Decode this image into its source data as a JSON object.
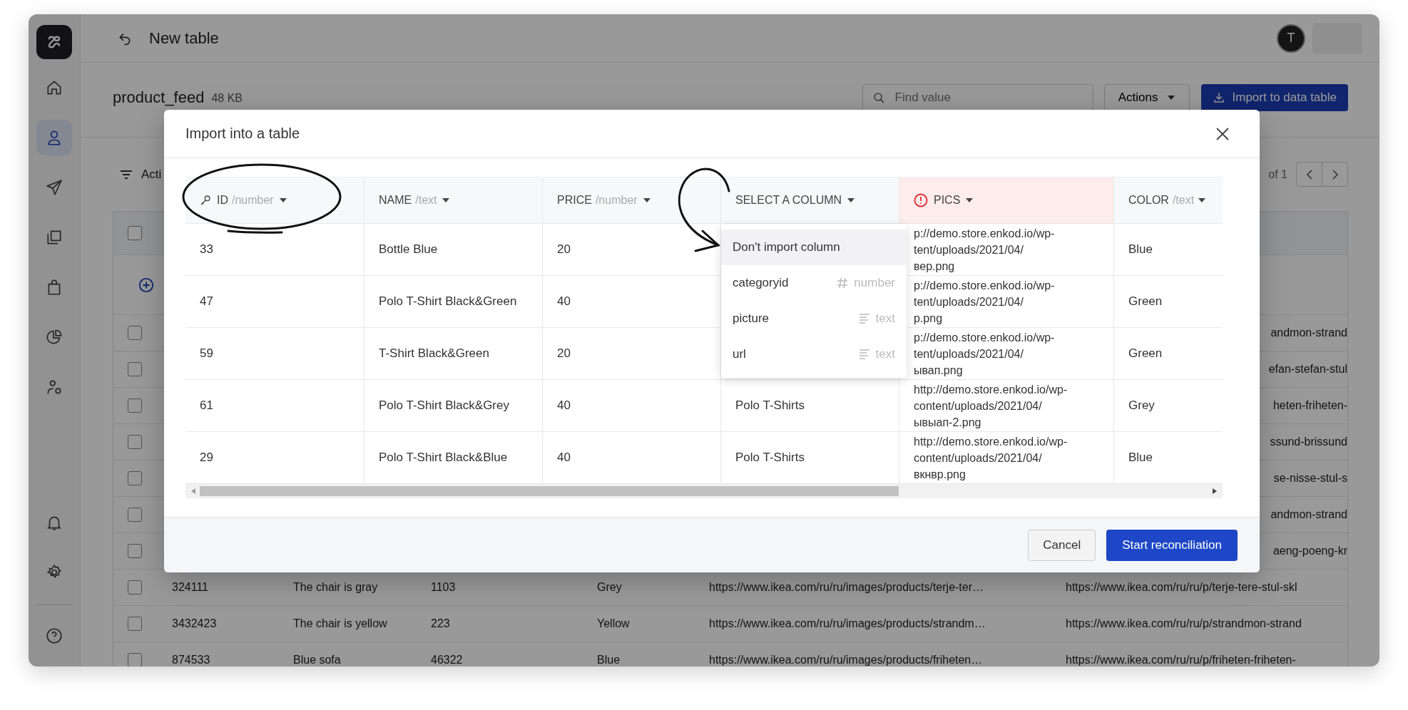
{
  "top_bar": {
    "title": "New table",
    "avatar": "T"
  },
  "sidebar": {
    "items": [
      {
        "selected": false
      },
      {
        "selected": true
      },
      {
        "selected": false
      },
      {
        "selected": false
      },
      {
        "selected": false
      },
      {
        "selected": false
      },
      {
        "selected": false
      }
    ]
  },
  "page": {
    "title": "product_feed",
    "size": "48 KB",
    "search": {
      "placeholder": "Find value"
    },
    "actions": "Actions",
    "import_button": "Import to data table",
    "toolbar_label": "Acti",
    "page_total": "of 1"
  },
  "data_table": {
    "all_checked": false,
    "rows": [
      {
        "kind": "partial",
        "checked": false,
        "fragment": "andmon-strand"
      },
      {
        "kind": "partial",
        "checked": false,
        "fragment": "efan-stefan-stul"
      },
      {
        "kind": "partial",
        "checked": false,
        "fragment": "heten-friheten-"
      },
      {
        "kind": "partial",
        "checked": false,
        "fragment": "ssund-brissund"
      },
      {
        "kind": "partial",
        "checked": false,
        "fragment": "se-nisse-stul-s"
      },
      {
        "kind": "partial",
        "checked": false,
        "fragment": "andmon-strand"
      },
      {
        "kind": "partial",
        "checked": false,
        "fragment": "aeng-poeng-kr"
      },
      {
        "kind": "full",
        "checked": false,
        "cells": [
          "324111",
          "The chair is gray",
          "1103",
          "Grey",
          "https://www.ikea.com/ru/ru/images/products/terje-ter…",
          "https://www.ikea.com/ru/ru/p/terje-tere-stul-skl"
        ]
      },
      {
        "kind": "full",
        "checked": false,
        "cells": [
          "3432423",
          "The chair is yellow",
          "223",
          "Yellow",
          "https://www.ikea.com/ru/ru/images/products/strandm…",
          "https://www.ikea.com/ru/ru/p/strandmon-strand"
        ]
      },
      {
        "kind": "full",
        "checked": false,
        "cells": [
          "874533",
          "Blue sofa",
          "46322",
          "Blue",
          "https://www.ikea.com/ru/ru/images/products/friheten…",
          "https://www.ikea.com/ru/ru/p/friheten-friheten-"
        ]
      }
    ]
  },
  "dialog": {
    "title": "Import into a table",
    "columns": [
      {
        "label": "ID",
        "type": "/number",
        "key": true,
        "error": false
      },
      {
        "label": "NAME",
        "type": "/text",
        "key": false,
        "error": false
      },
      {
        "label": "PRICE",
        "type": "/number",
        "key": false,
        "error": false
      },
      {
        "label": "SELECT A COLUMN",
        "key": false,
        "error": false
      },
      {
        "label": "PICS",
        "key": false,
        "error": true
      },
      {
        "label": "COLOR",
        "type": "/text",
        "key": false,
        "error": false
      }
    ],
    "rows": [
      {
        "id": "33",
        "name": "Bottle Blue",
        "price": "20",
        "pics": "p://demo.store.enkod.io/wp-\ntent/uploads/2021/04/\nвер.png",
        "color_text": "Blue"
      },
      {
        "id": "47",
        "name": "Polo T-Shirt Black&Green",
        "price": "40",
        "pics": "p://demo.store.enkod.io/wp-\ntent/uploads/2021/04/\np.png",
        "color_text": "Green"
      },
      {
        "id": "59",
        "name": "T-Shirt Black&Green",
        "price": "20",
        "pics": "p://demo.store.enkod.io/wp-\ntent/uploads/2021/04/\nывап.png",
        "color_text": "Green"
      },
      {
        "id": "61",
        "name": "Polo T-Shirt Black&Grey",
        "price": "40",
        "select_column": "Polo T-Shirts",
        "pics": "http://demo.store.enkod.io/wp-\ncontent/uploads/2021/04/\nывыап-2.png",
        "color_text": "Grey"
      },
      {
        "id": "29",
        "name": "Polo T-Shirt Black&Blue",
        "price": "40",
        "select_column": "Polo T-Shirts",
        "pics": "http://demo.store.enkod.io/wp-\ncontent/uploads/2021/04/\nвкнвр.png",
        "color_text": "Blue"
      }
    ],
    "dropdown": {
      "items": [
        {
          "label": "Don't import column",
          "selected": true
        },
        {
          "label": "categoryid",
          "kind": "number",
          "type": "number",
          "selected": false
        },
        {
          "label": "picture",
          "kind": "text",
          "type": "text",
          "selected": false
        },
        {
          "label": "url",
          "kind": "text",
          "type": "text",
          "selected": false
        }
      ]
    },
    "buttons": [
      {
        "label": "Cancel",
        "kind": "secondary"
      },
      {
        "label": "Start reconciliation",
        "kind": "primary"
      }
    ]
  }
}
